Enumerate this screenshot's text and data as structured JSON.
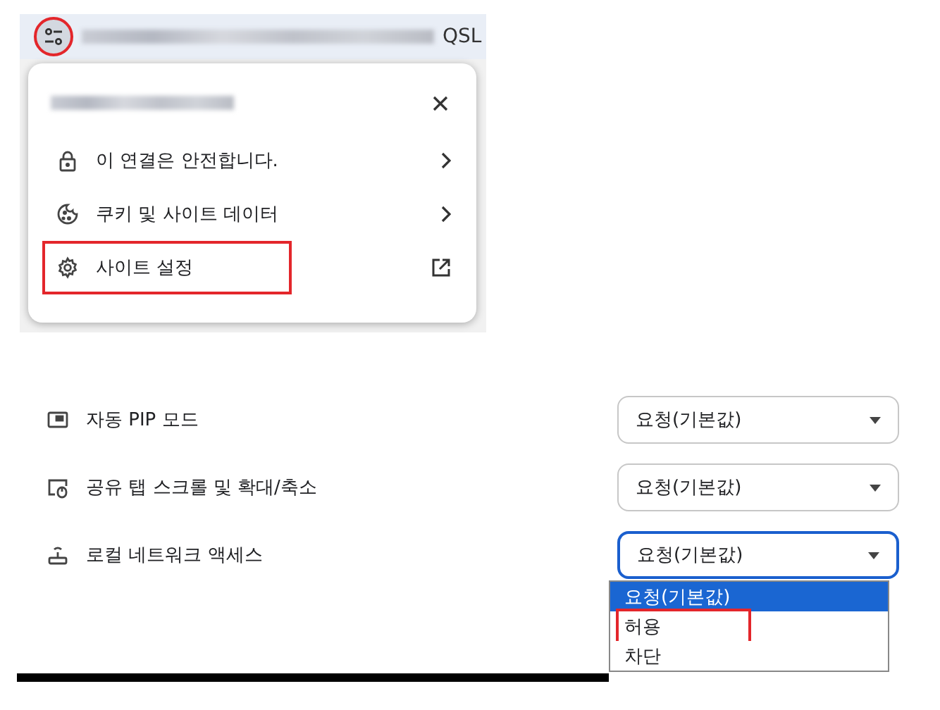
{
  "address_bar": {
    "url_tail": "QSL",
    "icon_annotated": true
  },
  "site_popup": {
    "items": [
      {
        "label": "이 연결은 안전합니다.",
        "kind": "nav",
        "annotated": false
      },
      {
        "label": "쿠키 및 사이트 데이터",
        "kind": "nav",
        "annotated": false
      },
      {
        "label": "사이트 설정",
        "kind": "external",
        "annotated": true
      }
    ]
  },
  "settings": [
    {
      "label": "자동 PIP 모드",
      "value": "요청(기본값)",
      "focused": false
    },
    {
      "label": "공유 탭 스크롤 및 확대/축소",
      "value": "요청(기본값)",
      "focused": false
    },
    {
      "label": "로컬 네트워크 액세스",
      "value": "요청(기본값)",
      "focused": true
    }
  ],
  "dropdown": {
    "options": [
      {
        "label": "요청(기본값)",
        "selected": true,
        "annotated": false
      },
      {
        "label": "허용",
        "selected": false,
        "annotated": true
      },
      {
        "label": "차단",
        "selected": false,
        "annotated": false
      }
    ]
  }
}
